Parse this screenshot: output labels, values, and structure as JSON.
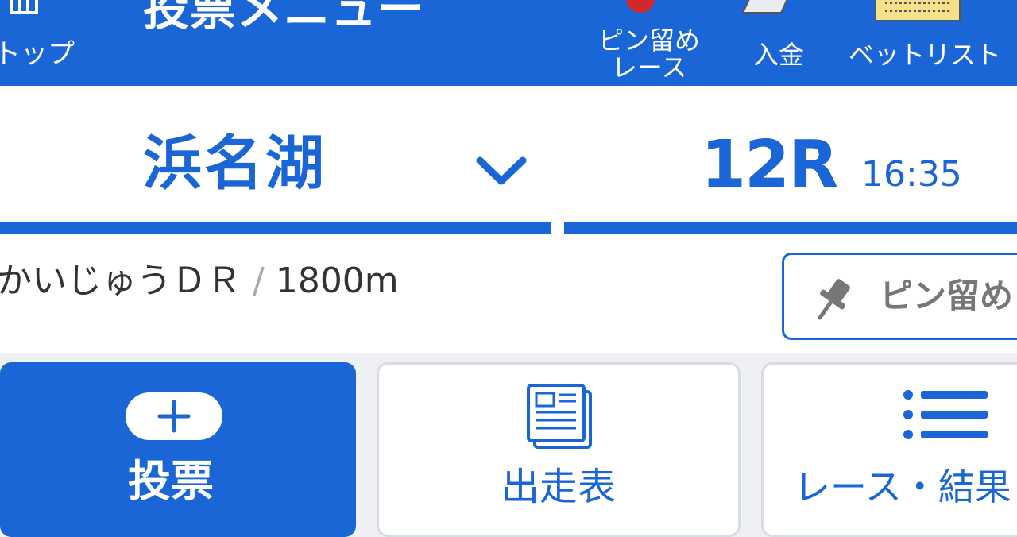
{
  "header": {
    "top_label": "トップ",
    "title": "投票メニュー",
    "pin_race_line1": "ピン留め",
    "pin_race_line2": "レース",
    "deposit": "入金",
    "bet_list": "ベットリスト",
    "icons": [
      "home-icon",
      "pin-ball-icon",
      "deposit-icon",
      "bet-list-icon"
    ]
  },
  "selector": {
    "venue": "浜名湖",
    "race_number": "12R",
    "race_time": "16:35"
  },
  "race_info": {
    "race_name": "かいじゅうＤＲ",
    "separator": "/",
    "distance": "1800m",
    "pin_button": "ピン留め"
  },
  "actions": [
    {
      "label": "投票",
      "icon": "plus-icon"
    },
    {
      "label": "出走表",
      "icon": "newspaper-icon"
    },
    {
      "label": "レース・結果",
      "icon": "list-icon"
    }
  ],
  "colors": {
    "accent": "#1a66d6",
    "background": "#eef0f4",
    "text": "#333333"
  }
}
